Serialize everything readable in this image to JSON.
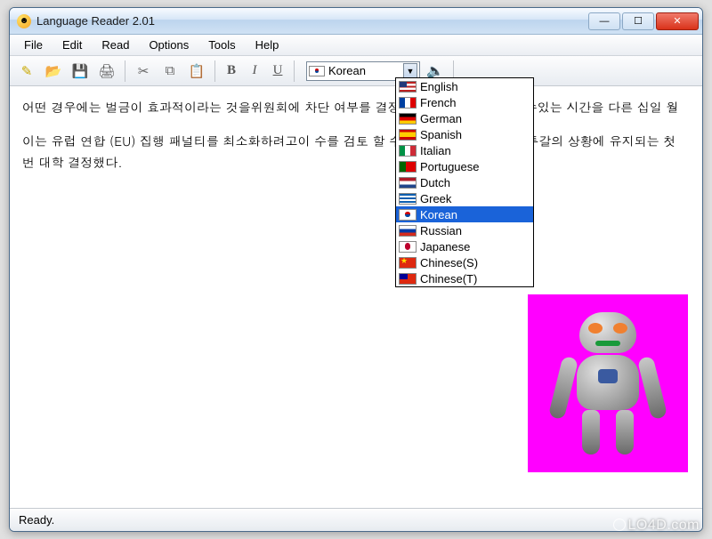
{
  "window": {
    "title": "Language Reader 2.01"
  },
  "menubar": [
    "File",
    "Edit",
    "Read",
    "Options",
    "Tools",
    "Help"
  ],
  "toolbar": {
    "language_selected": "Korean",
    "language_flag": "flag-kr"
  },
  "languages": [
    {
      "name": "English",
      "flag": "flag-us",
      "selected": false
    },
    {
      "name": "French",
      "flag": "flag-fr",
      "selected": false
    },
    {
      "name": "German",
      "flag": "flag-de",
      "selected": false
    },
    {
      "name": "Spanish",
      "flag": "flag-es",
      "selected": false
    },
    {
      "name": "Italian",
      "flag": "flag-it",
      "selected": false
    },
    {
      "name": "Portuguese",
      "flag": "flag-pt",
      "selected": false
    },
    {
      "name": "Dutch",
      "flag": "flag-nl",
      "selected": false
    },
    {
      "name": "Greek",
      "flag": "flag-gr",
      "selected": false
    },
    {
      "name": "Korean",
      "flag": "flag-kr",
      "selected": true
    },
    {
      "name": "Russian",
      "flag": "flag-ru",
      "selected": false
    },
    {
      "name": "Japanese",
      "flag": "flag-jp",
      "selected": false
    },
    {
      "name": "Chinese(S)",
      "flag": "flag-cn",
      "selected": false
    },
    {
      "name": "Chinese(T)",
      "flag": "flag-tw",
      "selected": false
    }
  ],
  "document": {
    "para1": "어떤 경우에는 벌금이 효과적이라는 것을위원회에                       차단 여부를 결정하는 이사회가 사용할 수있는 시간을 다른 십일 월",
    "para2": "이는 유럽 연합 (EU) 집행 패널티를 최소화하려고이              수를 검토 할 수 있었다 스페인과 포르투갈의 상황에 유지되는 첫 번              대학 결정했다."
  },
  "statusbar": {
    "text": "Ready."
  },
  "watermark": "LO4D.com"
}
